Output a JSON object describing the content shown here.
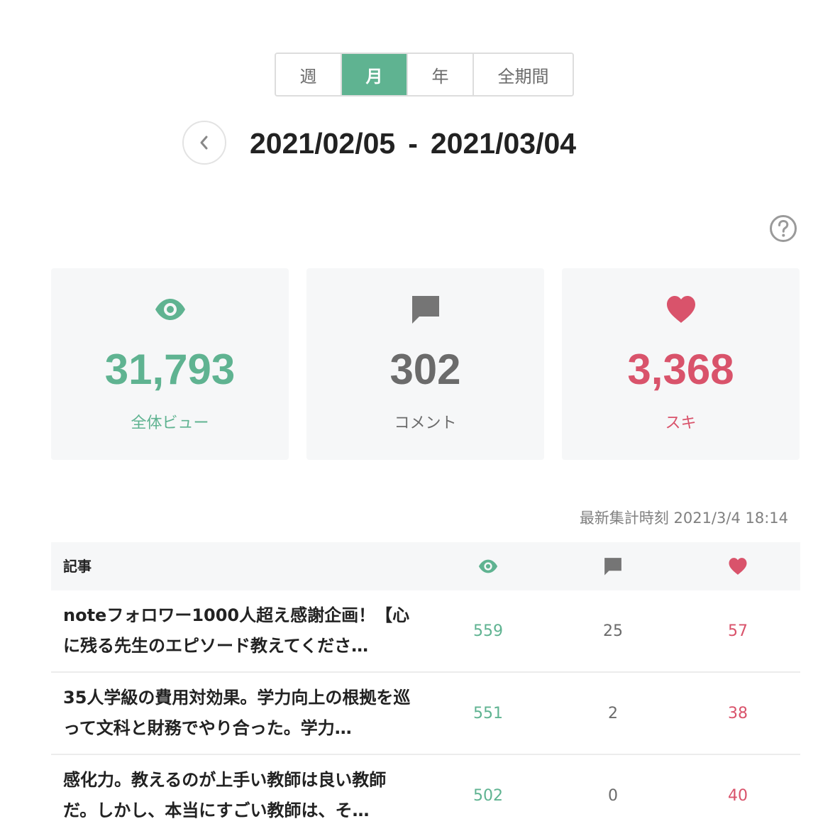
{
  "period_tabs": [
    {
      "label": "週",
      "active": false
    },
    {
      "label": "月",
      "active": true
    },
    {
      "label": "年",
      "active": false
    },
    {
      "label": "全期間",
      "active": false
    }
  ],
  "date_range": {
    "start": "2021/02/05",
    "separator": "-",
    "end": "2021/03/04"
  },
  "stats": {
    "views": {
      "value": "31,793",
      "label": "全体ビュー",
      "icon": "eye-icon",
      "color": "#5fb391"
    },
    "comments": {
      "value": "302",
      "label": "コメント",
      "icon": "comment-icon",
      "color": "#6b6b6b"
    },
    "likes": {
      "value": "3,368",
      "label": "スキ",
      "icon": "heart-icon",
      "color": "#d9536b"
    }
  },
  "updated_at": "最新集計時刻 2021/3/4 18:14",
  "table": {
    "header": {
      "article": "記事",
      "views_icon": "eye-icon",
      "comments_icon": "comment-icon",
      "likes_icon": "heart-icon"
    },
    "rows": [
      {
        "title": "noteフォロワー1000人超え感謝企画！【心に残る先生のエピソード教えてくださ…",
        "views": "559",
        "comments": "25",
        "likes": "57"
      },
      {
        "title": "35人学級の費用対効果。学力向上の根拠を巡って文科と財務でやり合った。学力…",
        "views": "551",
        "comments": "2",
        "likes": "38"
      },
      {
        "title": "感化力。教えるのが上手い教師は良い教師だ。しかし、本当にすごい教師は、そ…",
        "views": "502",
        "comments": "0",
        "likes": "40"
      }
    ]
  }
}
